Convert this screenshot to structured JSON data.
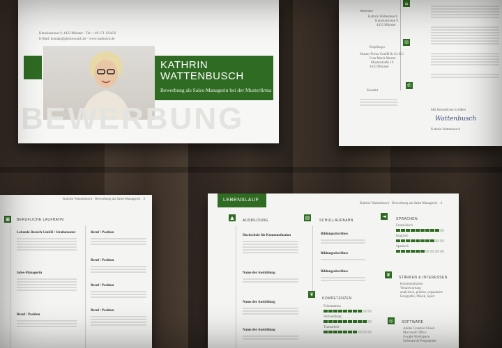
{
  "colors": {
    "accent": "#2f6b22",
    "wood": "#2f2822",
    "paper": "#f4f4f2"
  },
  "cover": {
    "address": "Kutusiastrasse 9, 4433 Münster  ·  Tel.: +49 171 123456",
    "contact": "E-Mail: kontakt@photoswatch.de  ·  www.watbusch.de",
    "first_name": "KATHRIN",
    "last_name": "WATTENBUSCH",
    "subtitle": "Bewerbung als Sales-Managerin bei der Musterfirma",
    "watermark": "BEWERBUNG"
  },
  "letter": {
    "sender_label": "Absender",
    "sender_lines": [
      "Kathrin Wattenbusch",
      "Kutusiastrasse 9",
      "4433 Münster"
    ],
    "recipient_label": "Empfänger",
    "recipient_lines": [
      "Muster Firma GmbH & Co KG",
      "Frau Maria Muster",
      "Musterstraße 19",
      "4433 Münster"
    ],
    "contact_label": "Kontakt",
    "closing": "Mit freundlichen Grüßen",
    "signature": "Wattenbusch",
    "signer": "Kathrin Wattenbusch"
  },
  "page_left": {
    "header": "Kathrin Wattenbusch · Bewerbung als Sales-Managerin · 3",
    "section": "BERUFLICHE LAUFBAHN",
    "entries": [
      "Leitende Bereich GmbH / Straßenautor",
      "Sales-Managerin",
      "Beruf / Position"
    ],
    "right_entries": [
      "Beruf / Position",
      "Beruf / Position",
      "Beruf / Position",
      "Beruf / Position"
    ]
  },
  "cv": {
    "tab": "LEBENSLAUF",
    "header": "Kathrin Wattenbusch · Bewerbung als Sales-Managerin · 4",
    "education_title": "AUSBILDUNG",
    "education_entries": [
      "Hochschule für Kommunikation",
      "Name der Ausbildung",
      "Name der Ausbildung",
      "Name der Ausbildung"
    ],
    "school_title": "SCHULLAUFBAHN",
    "school_entries": [
      "Bildungsabschluss",
      "Bildungsabschluss",
      "Bildungsabschluss"
    ],
    "skills_title": "KOMPETENZEN",
    "skills": [
      {
        "name": "Präsentation",
        "level": 0.8
      },
      {
        "name": "Verhandlung",
        "level": 0.9
      },
      {
        "name": "Teamarbeit",
        "level": 0.7
      }
    ],
    "languages_title": "SPRACHEN",
    "languages": [
      {
        "name": "Französisch",
        "level": 0.9
      },
      {
        "name": "Englisch",
        "level": 0.8
      },
      {
        "name": "Spanisch",
        "level": 0.6
      }
    ],
    "strengths_title": "STÄRKEN & INTERESSEN",
    "strengths": [
      "Kommunikation",
      "Verantwortung",
      "analytisch, präzise, organisiert",
      "Fotografie, Musik, Sport"
    ],
    "software_title": "SOFTWARE",
    "software": [
      "Adobe Creative Cloud",
      "Microsoft Office",
      "Google Workspace",
      "Software & Programme"
    ]
  }
}
